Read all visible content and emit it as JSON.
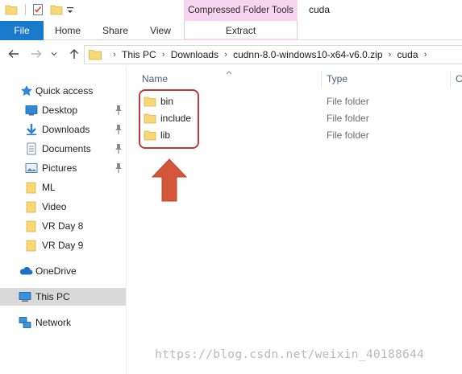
{
  "window": {
    "title": "cuda",
    "context_tab_group": "Compressed Folder Tools"
  },
  "ribbon": {
    "tabs": [
      {
        "label": "File"
      },
      {
        "label": "Home"
      },
      {
        "label": "Share"
      },
      {
        "label": "View"
      },
      {
        "label": "Extract"
      }
    ]
  },
  "address_bar": {
    "crumbs": [
      "This PC",
      "Downloads",
      "cudnn-8.0-windows10-x64-v6.0.zip",
      "cuda"
    ]
  },
  "nav_pane": {
    "quick_access": {
      "label": "Quick access"
    },
    "items": [
      {
        "label": "Desktop",
        "icon": "desktop-icon",
        "pinned": true
      },
      {
        "label": "Downloads",
        "icon": "download-arrow-icon",
        "pinned": true
      },
      {
        "label": "Documents",
        "icon": "documents-icon",
        "pinned": true
      },
      {
        "label": "Pictures",
        "icon": "pictures-icon",
        "pinned": true
      },
      {
        "label": "ML",
        "icon": "folder-icon",
        "pinned": false
      },
      {
        "label": "Video",
        "icon": "folder-icon",
        "pinned": false
      },
      {
        "label": "VR Day 8",
        "icon": "folder-icon",
        "pinned": false
      },
      {
        "label": "VR Day 9",
        "icon": "folder-icon",
        "pinned": false
      }
    ],
    "onedrive": {
      "label": "OneDrive"
    },
    "this_pc": {
      "label": "This PC",
      "selected": true
    },
    "network": {
      "label": "Network"
    }
  },
  "file_list": {
    "columns": {
      "name": "Name",
      "type": "Type",
      "extra": "C"
    },
    "rows": [
      {
        "name": "bin",
        "type": "File folder"
      },
      {
        "name": "include",
        "type": "File folder"
      },
      {
        "name": "lib",
        "type": "File folder"
      }
    ]
  },
  "annotation": {
    "highlight_color": "#c0393b",
    "arrow_color": "#d4573a"
  },
  "watermark": "https://blog.csdn.net/weixin_40188644",
  "colors": {
    "file_tab": "#1979ca",
    "context_tab": "#f7d5f1",
    "folder": "#f8d775",
    "selected_nav": "#d9d9d9"
  }
}
